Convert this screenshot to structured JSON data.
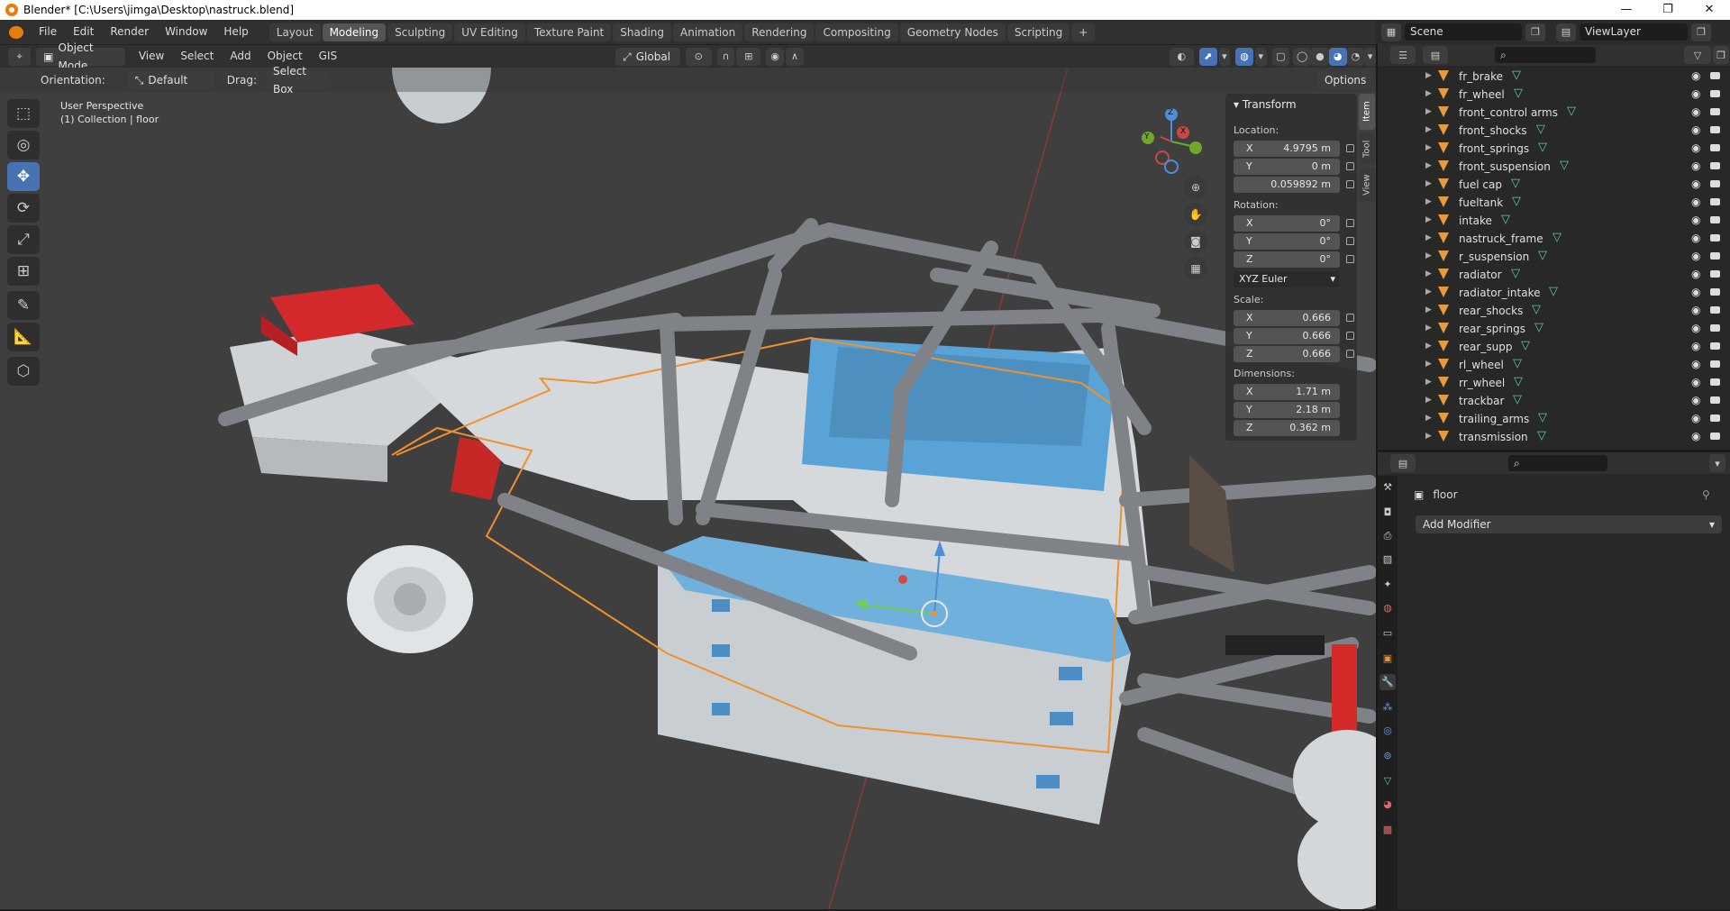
{
  "window": {
    "title": "Blender* [C:\\Users\\jimga\\Desktop\\nastruck.blend]",
    "minimize": "—",
    "restore": "❐",
    "close": "✕"
  },
  "menu": [
    "File",
    "Edit",
    "Render",
    "Window",
    "Help"
  ],
  "workspaces": [
    "Layout",
    "Modeling",
    "Sculpting",
    "UV Editing",
    "Texture Paint",
    "Shading",
    "Animation",
    "Rendering",
    "Compositing",
    "Geometry Nodes",
    "Scripting",
    "+"
  ],
  "active_workspace": "Modeling",
  "scene": {
    "name": "Scene",
    "view_layer": "ViewLayer"
  },
  "viewport_header": {
    "mode": "Object Mode",
    "menus": [
      "View",
      "Select",
      "Add",
      "Object",
      "GIS"
    ],
    "transform_orientation": "Global"
  },
  "tool_settings": {
    "orientation_label": "Orientation:",
    "orientation_value": "Default",
    "drag_label": "Drag:",
    "drag_value": "Select Box",
    "options": "Options"
  },
  "overlay_text": {
    "perspective": "User Perspective",
    "collection": "(1) Collection | floor"
  },
  "gizmo": {
    "x": "X",
    "y": "Y",
    "z": "Z"
  },
  "npanel": {
    "section": "Transform",
    "location_label": "Location:",
    "location": [
      {
        "axis": "X",
        "value": "4.9795 m"
      },
      {
        "axis": "Y",
        "value": "0 m"
      },
      {
        "axis": "",
        "value": "0.059892 m"
      }
    ],
    "rotation_label": "Rotation:",
    "rotation": [
      {
        "axis": "X",
        "value": "0°"
      },
      {
        "axis": "Y",
        "value": "0°"
      },
      {
        "axis": "Z",
        "value": "0°"
      }
    ],
    "rotation_mode": "XYZ Euler",
    "scale_label": "Scale:",
    "scale": [
      {
        "axis": "X",
        "value": "0.666"
      },
      {
        "axis": "Y",
        "value": "0.666"
      },
      {
        "axis": "Z",
        "value": "0.666"
      }
    ],
    "dimensions_label": "Dimensions:",
    "dimensions": [
      {
        "axis": "X",
        "value": "1.71 m"
      },
      {
        "axis": "Y",
        "value": "2.18 m"
      },
      {
        "axis": "Z",
        "value": "0.362 m"
      }
    ],
    "tabs": [
      "Item",
      "Tool",
      "View"
    ]
  },
  "outliner": {
    "items": [
      "fr_brake",
      "fr_wheel",
      "front_control arms",
      "front_shocks",
      "front_springs",
      "front_suspension",
      "fuel cap",
      "fueltank",
      "intake",
      "nastruck_frame",
      "r_suspension",
      "radiator",
      "radiator_intake",
      "rear_shocks",
      "rear_springs",
      "rear_supp",
      "rl_wheel",
      "rr_wheel",
      "trackbar",
      "trailing_arms",
      "transmission"
    ]
  },
  "properties": {
    "object_name": "floor",
    "add_modifier": "Add Modifier"
  },
  "colors": {
    "accent": "#4772b3",
    "selection": "#f0912e",
    "red_part": "#d42a2a",
    "blue_panel": "#5aa3d6"
  }
}
